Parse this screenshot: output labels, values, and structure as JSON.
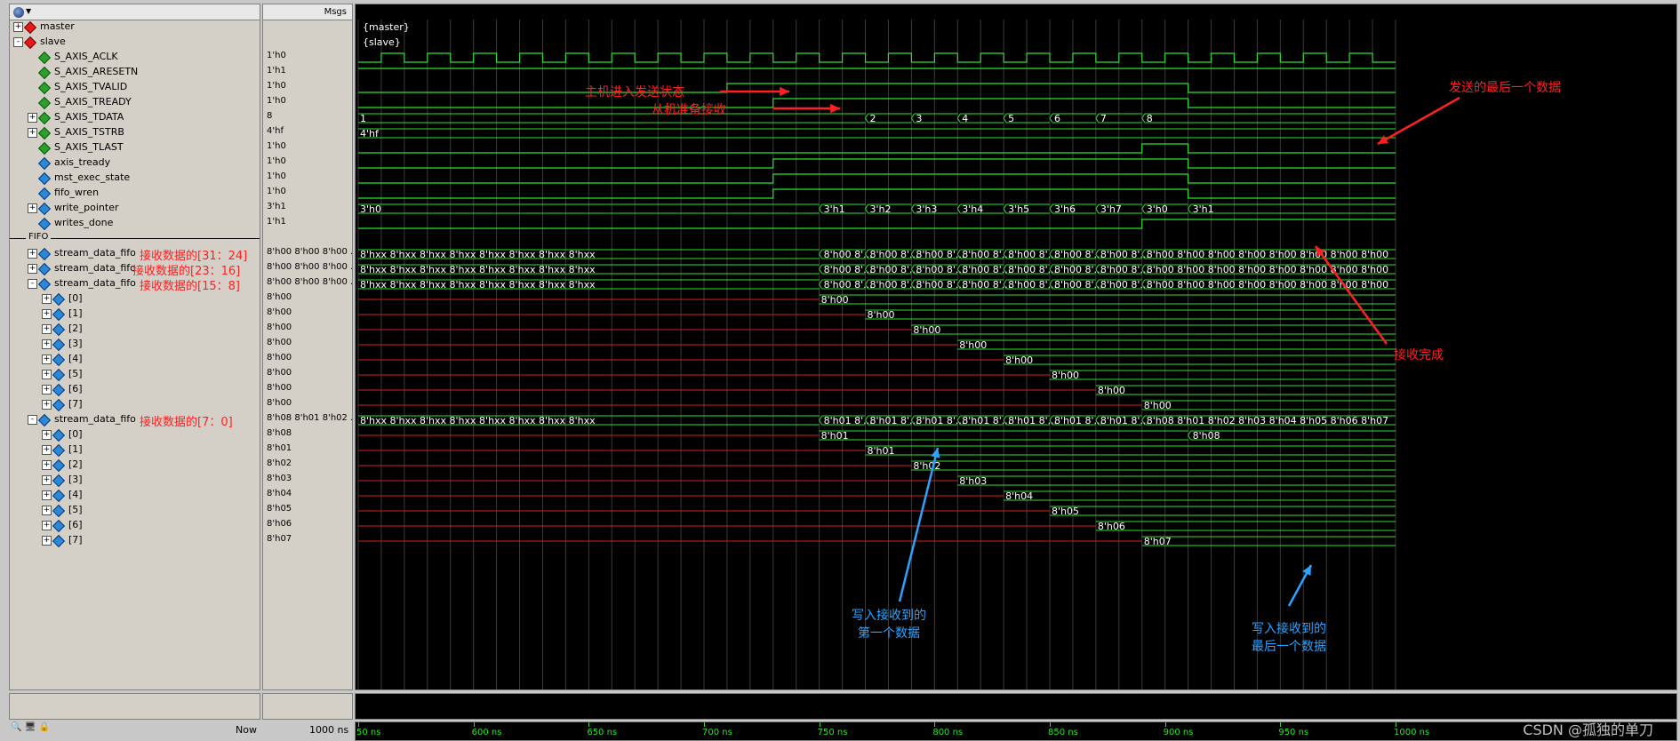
{
  "header": {
    "msgs_label": "Msgs"
  },
  "signals": [
    {
      "name": "master",
      "value": "",
      "type": "group",
      "indent": 0,
      "expander": "+",
      "icon": "red"
    },
    {
      "name": "slave",
      "value": "",
      "type": "group",
      "indent": 0,
      "expander": "-",
      "icon": "red"
    },
    {
      "name": "S_AXIS_ACLK",
      "value": "1'h0",
      "type": "bit",
      "indent": 1,
      "expander": "",
      "icon": "green"
    },
    {
      "name": "S_AXIS_ARESETN",
      "value": "1'h1",
      "type": "bit",
      "indent": 1,
      "expander": "",
      "icon": "green"
    },
    {
      "name": "S_AXIS_TVALID",
      "value": "1'h0",
      "type": "bit",
      "indent": 1,
      "expander": "",
      "icon": "green"
    },
    {
      "name": "S_AXIS_TREADY",
      "value": "1'h0",
      "type": "bit",
      "indent": 1,
      "expander": "",
      "icon": "green"
    },
    {
      "name": "S_AXIS_TDATA",
      "value": "8",
      "type": "bus",
      "indent": 1,
      "expander": "+",
      "icon": "green"
    },
    {
      "name": "S_AXIS_TSTRB",
      "value": "4'hf",
      "type": "bus",
      "indent": 1,
      "expander": "+",
      "icon": "green"
    },
    {
      "name": "S_AXIS_TLAST",
      "value": "1'h0",
      "type": "bit",
      "indent": 1,
      "expander": "",
      "icon": "green"
    },
    {
      "name": "axis_tready",
      "value": "1'h0",
      "type": "bit",
      "indent": 1,
      "expander": "",
      "icon": "blue"
    },
    {
      "name": "mst_exec_state",
      "value": "1'h0",
      "type": "bit",
      "indent": 1,
      "expander": "",
      "icon": "blue"
    },
    {
      "name": "fifo_wren",
      "value": "1'h0",
      "type": "bit",
      "indent": 1,
      "expander": "",
      "icon": "blue"
    },
    {
      "name": "write_pointer",
      "value": "3'h1",
      "type": "bus",
      "indent": 1,
      "expander": "+",
      "icon": "blue"
    },
    {
      "name": "writes_done",
      "value": "1'h1",
      "type": "bit",
      "indent": 1,
      "expander": "",
      "icon": "blue"
    },
    {
      "name": "FIFO",
      "value": "",
      "type": "divider",
      "indent": 0,
      "expander": "",
      "icon": ""
    },
    {
      "name": "stream_data_fifo",
      "value": "8'h00 8'h00 8'h00 ...",
      "type": "bus",
      "indent": 1,
      "expander": "+",
      "icon": "blue",
      "annot": "接收数据的[31：24]"
    },
    {
      "name": "stream_data_fifo",
      "value": "8'h00 8'h00 8'h00 ...",
      "type": "bus",
      "indent": 1,
      "expander": "+",
      "icon": "blue",
      "annot": "接收数据的[23：16]"
    },
    {
      "name": "stream_data_fifo",
      "value": "8'h00 8'h00 8'h00 ...",
      "type": "bus",
      "indent": 1,
      "expander": "-",
      "icon": "blue",
      "annot": "接收数据的[15：8]"
    },
    {
      "name": "[0]",
      "value": "8'h00",
      "type": "sub",
      "indent": 2,
      "expander": "+",
      "icon": "blue"
    },
    {
      "name": "[1]",
      "value": "8'h00",
      "type": "sub",
      "indent": 2,
      "expander": "+",
      "icon": "blue"
    },
    {
      "name": "[2]",
      "value": "8'h00",
      "type": "sub",
      "indent": 2,
      "expander": "+",
      "icon": "blue"
    },
    {
      "name": "[3]",
      "value": "8'h00",
      "type": "sub",
      "indent": 2,
      "expander": "+",
      "icon": "blue"
    },
    {
      "name": "[4]",
      "value": "8'h00",
      "type": "sub",
      "indent": 2,
      "expander": "+",
      "icon": "blue"
    },
    {
      "name": "[5]",
      "value": "8'h00",
      "type": "sub",
      "indent": 2,
      "expander": "+",
      "icon": "blue"
    },
    {
      "name": "[6]",
      "value": "8'h00",
      "type": "sub",
      "indent": 2,
      "expander": "+",
      "icon": "blue"
    },
    {
      "name": "[7]",
      "value": "8'h00",
      "type": "sub",
      "indent": 2,
      "expander": "+",
      "icon": "blue"
    },
    {
      "name": "stream_data_fifo",
      "value": "8'h08 8'h01 8'h02 ...",
      "type": "bus",
      "indent": 1,
      "expander": "-",
      "icon": "blue",
      "annot": "接收数据的[7：0]"
    },
    {
      "name": "[0]",
      "value": "8'h08",
      "type": "sub",
      "indent": 2,
      "expander": "+",
      "icon": "blue"
    },
    {
      "name": "[1]",
      "value": "8'h01",
      "type": "sub",
      "indent": 2,
      "expander": "+",
      "icon": "blue"
    },
    {
      "name": "[2]",
      "value": "8'h02",
      "type": "sub",
      "indent": 2,
      "expander": "+",
      "icon": "blue"
    },
    {
      "name": "[3]",
      "value": "8'h03",
      "type": "sub",
      "indent": 2,
      "expander": "+",
      "icon": "blue"
    },
    {
      "name": "[4]",
      "value": "8'h04",
      "type": "sub",
      "indent": 2,
      "expander": "+",
      "icon": "blue"
    },
    {
      "name": "[5]",
      "value": "8'h05",
      "type": "sub",
      "indent": 2,
      "expander": "+",
      "icon": "blue"
    },
    {
      "name": "[6]",
      "value": "8'h06",
      "type": "sub",
      "indent": 2,
      "expander": "+",
      "icon": "blue"
    },
    {
      "name": "[7]",
      "value": "8'h07",
      "type": "sub",
      "indent": 2,
      "expander": "+",
      "icon": "blue"
    }
  ],
  "waves": {
    "master_label": "{master}",
    "slave_label": "{slave}",
    "tdata_values": [
      "1",
      "2",
      "3",
      "4",
      "5",
      "6",
      "7",
      "8"
    ],
    "tstrb_value": "4'hf",
    "write_pointer_values": [
      "3'h0",
      "3'h1",
      "3'h2",
      "3'h3",
      "3'h4",
      "3'h5",
      "3'h6",
      "3'h7",
      "3'h0",
      "3'h1"
    ],
    "fifo_initial": "8'hxx 8'hxx 8'hxx 8'hxx 8'hxx 8'hxx 8'hxx 8'hxx",
    "fifo_step": "8'h00 8'...",
    "fifo_final_upper": "8'h00 8'h00 8'h00 8'h00 8'h00 8'h00 8'h00 8'h00",
    "fifo_lower_step": "8'h01 8'...",
    "fifo_lower_final": "8'h08 8'h01 8'h02 8'h03 8'h04 8'h05 8'h06 8'h07",
    "upper_sub_values": [
      "8'h00",
      "8'h00",
      "8'h00",
      "8'h00",
      "8'h00",
      "8'h00",
      "8'h00",
      "8'h00"
    ],
    "lower_sub_values": [
      "8'h01",
      "8'h01",
      "8'h02",
      "8'h03",
      "8'h04",
      "8'h05",
      "8'h06",
      "8'h07"
    ],
    "lower_sub0_final": "8'h08"
  },
  "annotations": {
    "master_send": "主机进入发送状态",
    "slave_ready": "从机准备接收",
    "last_data": "发送的最后一个数据",
    "recv_done": "接收完成",
    "write_first_l1": "写入接收到的",
    "write_first_l2": "第一个数据",
    "write_last_l1": "写入接收到的",
    "write_last_l2": "最后一个数据"
  },
  "bottom": {
    "now_label": "Now",
    "now_value": "1000 ns"
  },
  "timeline": {
    "ticks": [
      "50 ns",
      "600 ns",
      "650 ns",
      "700 ns",
      "750 ns",
      "800 ns",
      "850 ns",
      "900 ns",
      "950 ns",
      "1000 ns"
    ]
  },
  "watermark": "CSDN @孤独的单刀",
  "colors": {
    "wave_green": "#2ee02e",
    "wave_red": "#d42020",
    "annot_red": "#ff2020",
    "annot_blue": "#2ba3ff"
  }
}
